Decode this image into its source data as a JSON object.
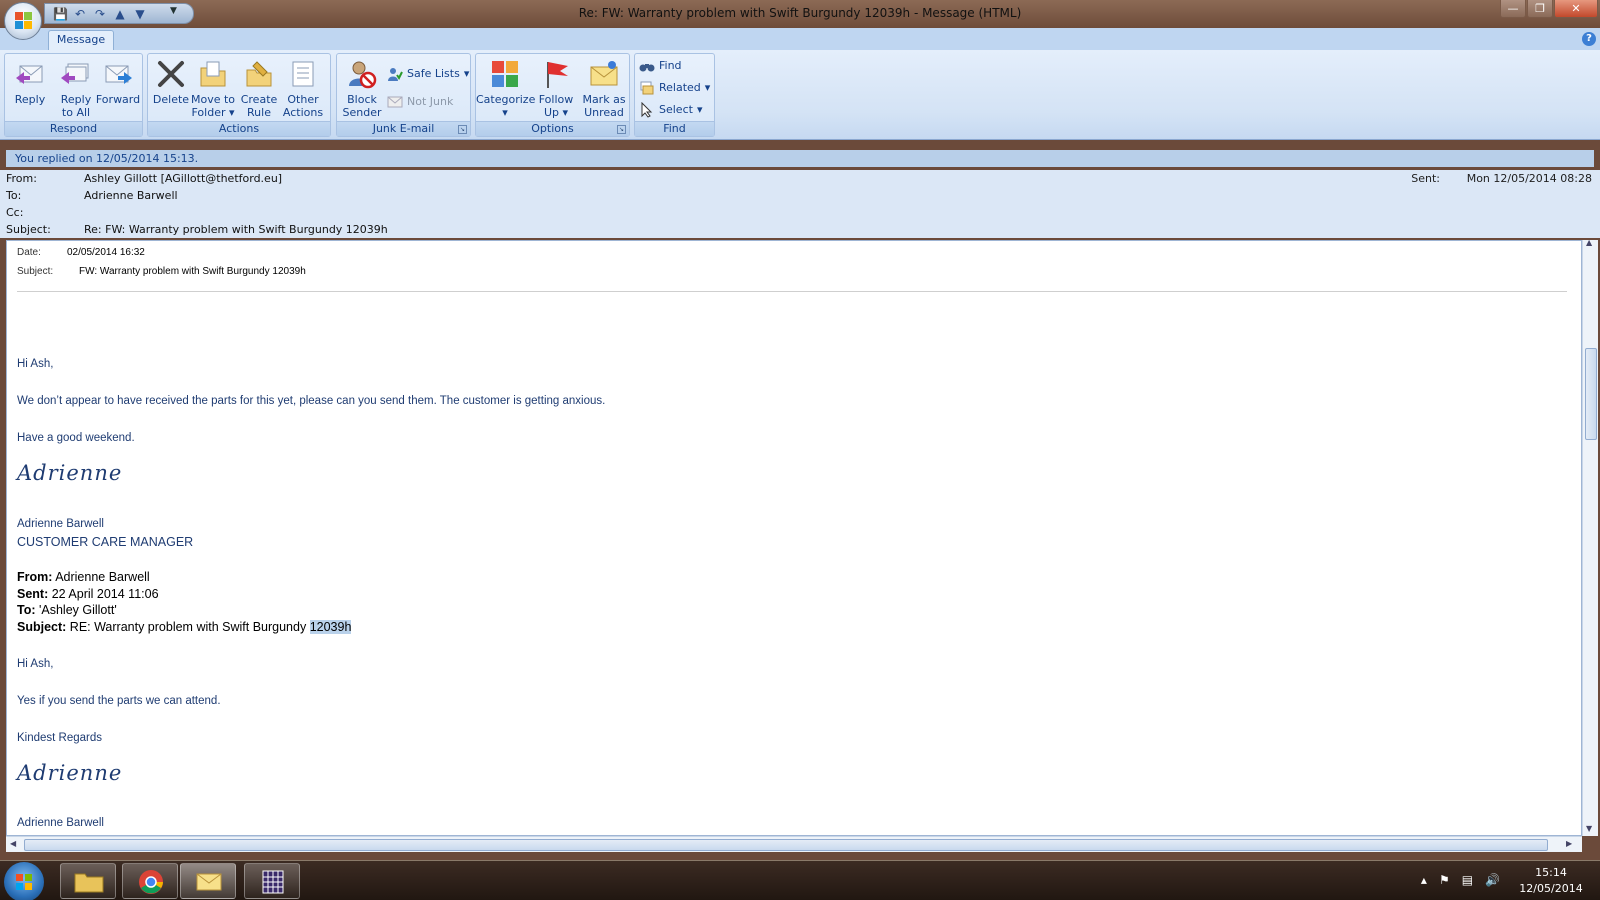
{
  "window": {
    "title": "Re: FW: Warranty problem with Swift Burgundy 12039h  -  Message (HTML)",
    "minimize": "—",
    "restore": "❐",
    "close": "✕"
  },
  "ribbon": {
    "tab": "Message",
    "help": "?",
    "groups": {
      "respond": "Respond",
      "actions": "Actions",
      "junk": "Junk E-mail",
      "options": "Options",
      "find": "Find"
    },
    "buttons": {
      "reply": "Reply",
      "reply_all_1": "Reply",
      "reply_all_2": "to All",
      "forward": "Forward",
      "delete": "Delete",
      "move_1": "Move to",
      "move_2": "Folder",
      "create_1": "Create",
      "create_2": "Rule",
      "other_1": "Other",
      "other_2": "Actions",
      "block_1": "Block",
      "block_2": "Sender",
      "safe_lists": "Safe Lists",
      "not_junk": "Not Junk",
      "categorize": "Categorize",
      "follow_1": "Follow",
      "follow_2": "Up",
      "mark_1": "Mark as",
      "mark_2": "Unread",
      "find": "Find",
      "related": "Related",
      "select": "Select"
    }
  },
  "header": {
    "info": "You replied on 12/05/2014 15:13.",
    "from_label": "From:",
    "from": "Ashley Gillott [AGillott@thetford.eu]",
    "to_label": "To:",
    "to": "Adrienne Barwell",
    "cc_label": "Cc:",
    "cc": "",
    "subject_label": "Subject:",
    "subject": "Re: FW: Warranty problem with Swift Burgundy 12039h",
    "sent_label": "Sent:",
    "sent": "Mon 12/05/2014 08:28"
  },
  "body": {
    "date_label": "Date:",
    "date": "02/05/2014 16:32",
    "subject_label": "Subject:",
    "subject": "FW: Warranty problem with Swift Burgundy 12039h",
    "greeting1": "Hi Ash,",
    "para1": "We don’t appear to have received the parts for this yet, please can you send them.  The customer is getting anxious.",
    "para2": "Have a good weekend.",
    "signature": "Adrienne",
    "sig_name": "Adrienne Barwell",
    "sig_title": "CUSTOMER CARE MANAGER",
    "q_from_label": "From:",
    "q_from": " Adrienne Barwell",
    "q_sent_label": "Sent:",
    "q_sent": " 22 April 2014 11:06",
    "q_to_label": "To:",
    "q_to": " 'Ashley Gillott'",
    "q_subject_label": "Subject:",
    "q_subject": " RE: Warranty problem with Swift Burgundy ",
    "q_subject_hl": "12039h",
    "greeting2": "Hi Ash,",
    "para3": "Yes if you send the parts we can attend.",
    "regards": "Kindest Regards",
    "signature2": "Adrienne",
    "sig_name2": "Adrienne Barwell"
  },
  "taskbar": {
    "time": "15:14",
    "date": "12/05/2014"
  }
}
